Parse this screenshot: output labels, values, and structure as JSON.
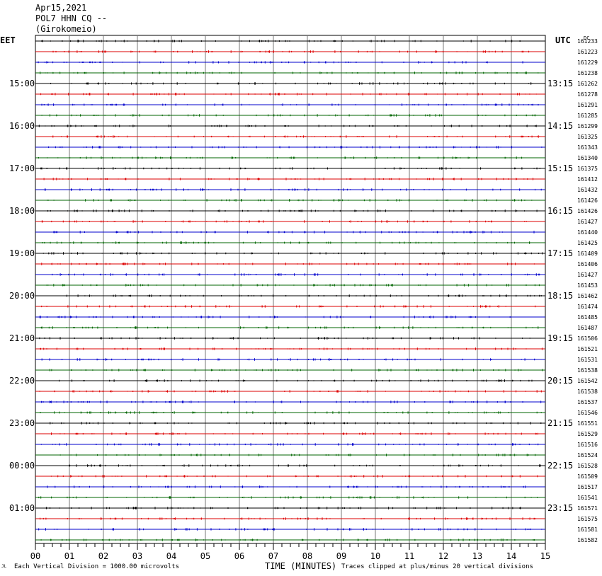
{
  "header": {
    "date": "Apr15,2021",
    "station": "POL7 HHN CQ --",
    "site": "(Girokomeio)"
  },
  "left_zone": "EET",
  "right_zone": "UTC",
  "dc_label": "DC",
  "footer": {
    "scale_note": "Each Vertical Division = 1000.00 microvolts",
    "clip_note": "Traces clipped at plus/minus 20 vertical divisions",
    "corner_mark": "JL"
  },
  "chart_data": {
    "type": "line",
    "title": "",
    "xlabel": "TIME (MINUTES)",
    "x_ticks": [
      "00",
      "01",
      "02",
      "03",
      "04",
      "05",
      "06",
      "07",
      "08",
      "09",
      "10",
      "11",
      "12",
      "13",
      "14",
      "15"
    ],
    "xlim": [
      0,
      15
    ],
    "left_hour_labels": [
      "15:00",
      "16:00",
      "17:00",
      "18:00",
      "19:00",
      "20:00",
      "21:00",
      "22:00",
      "23:00",
      "00:00",
      "01:00"
    ],
    "right_hour_labels": [
      "13:15",
      "14:15",
      "15:15",
      "16:15",
      "17:15",
      "18:15",
      "19:15",
      "20:15",
      "21:15",
      "22:15",
      "23:15"
    ],
    "trace_colors": [
      "#000000",
      "#dd0000",
      "#0000cc",
      "#006600"
    ],
    "dc_offsets": [
      161233,
      161223,
      161229,
      161238,
      161262,
      161278,
      161291,
      161285,
      161299,
      161325,
      161343,
      161340,
      161375,
      161412,
      161432,
      161426,
      161426,
      161427,
      161440,
      161425,
      161409,
      161406,
      161427,
      161453,
      161462,
      161474,
      161485,
      161487,
      161506,
      161521,
      161531,
      161538,
      161542,
      161538,
      161537,
      161546,
      161551,
      161529,
      161516,
      161524,
      161528,
      161509,
      161517,
      161541,
      161571,
      161575,
      161581,
      161582
    ],
    "grid": true
  }
}
